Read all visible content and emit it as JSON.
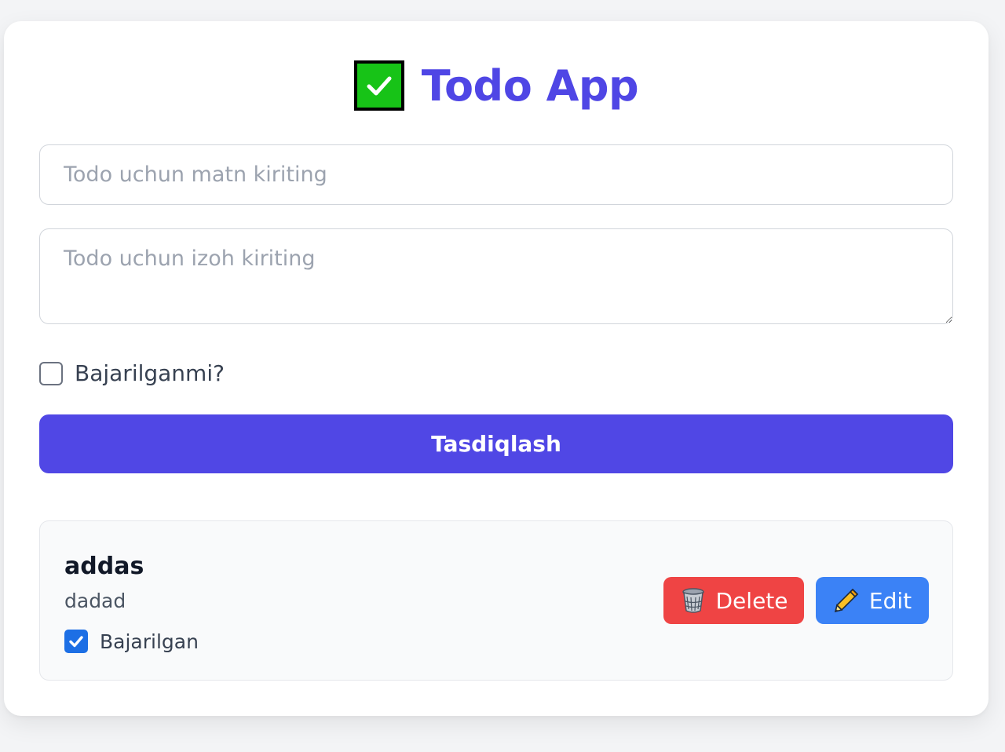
{
  "app": {
    "title": "Todo App",
    "title_icon": "check-mark-button-icon",
    "accent_color": "#4f46e5"
  },
  "form": {
    "text_placeholder": "Todo uchun matn kiriting",
    "text_value": "",
    "description_placeholder": "Todo uchun izoh kiriting",
    "description_value": "",
    "done_label": "Bajarilganmi?",
    "done_checked": false,
    "submit_label": "Tasdiqlash"
  },
  "todos": [
    {
      "title": "addas",
      "description": "dadad",
      "status_label": "Bajarilgan",
      "completed": true,
      "delete_label": "Delete",
      "delete_icon": "wastebasket-icon",
      "edit_label": "Edit",
      "edit_icon": "pencil-icon"
    }
  ],
  "colors": {
    "delete": "#ef4444",
    "edit": "#3b82f6",
    "submit": "#5047e5"
  }
}
